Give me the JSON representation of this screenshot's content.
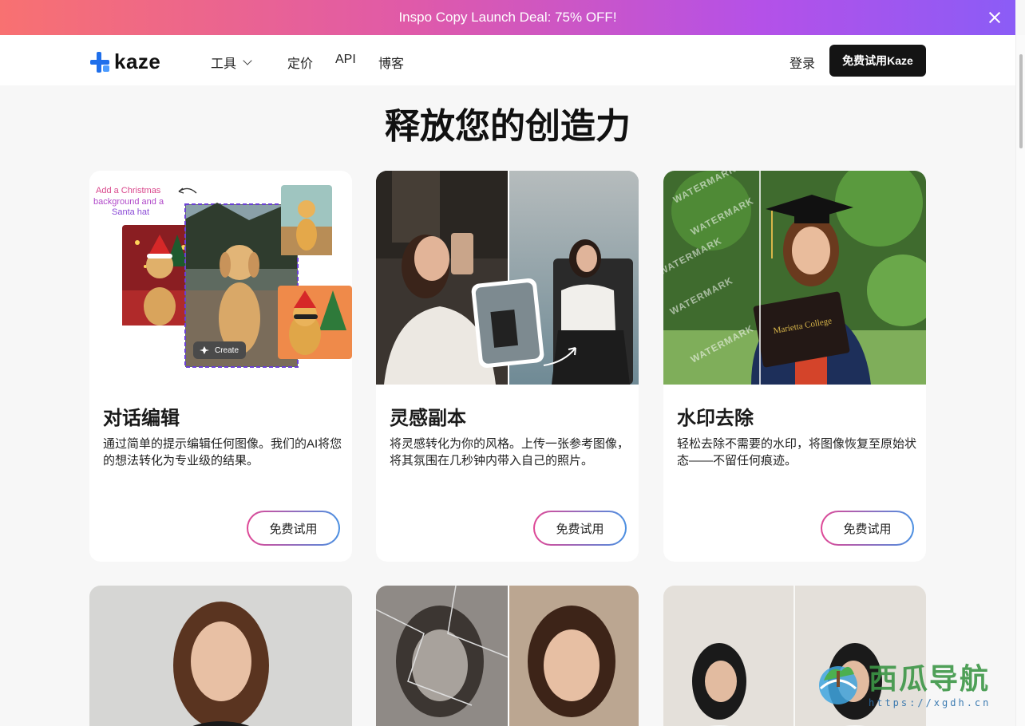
{
  "banner": {
    "text": "Inspo Copy Launch Deal: 75% OFF!"
  },
  "nav": {
    "logo": "kaze",
    "links": [
      "工具",
      "定价",
      "API",
      "博客"
    ],
    "login": "登录",
    "cta": "免费试用Kaze"
  },
  "headline": "释放您的创造力",
  "cards": [
    {
      "title": "对话编辑",
      "desc": "通过简单的提示编辑任何图像。我们的AI将您的想法转化为专业级的结果。",
      "button": "免费试用",
      "image_note": "Add a Christmas background and a Santa hat",
      "image_button": "Create"
    },
    {
      "title": "灵感副本",
      "desc": "将灵感转化为你的风格。上传一张参考图像，将其氛围在几秒钟内带入自己的照片。",
      "button": "免费试用"
    },
    {
      "title": "水印去除",
      "desc": "轻松去除不需要的水印，将图像恢复至原始状态——不留任何痕迹。",
      "button": "免费试用",
      "image_text": "WATERMARK",
      "image_label": "Marietta College"
    }
  ],
  "site_watermark": {
    "name": "西瓜导航",
    "url": "https://xgdh.cn"
  },
  "colors": {
    "banner_start": "#f87171",
    "banner_end": "#8b5cf6",
    "brand_blue": "#1f6feb",
    "cta_bg": "#141414"
  }
}
